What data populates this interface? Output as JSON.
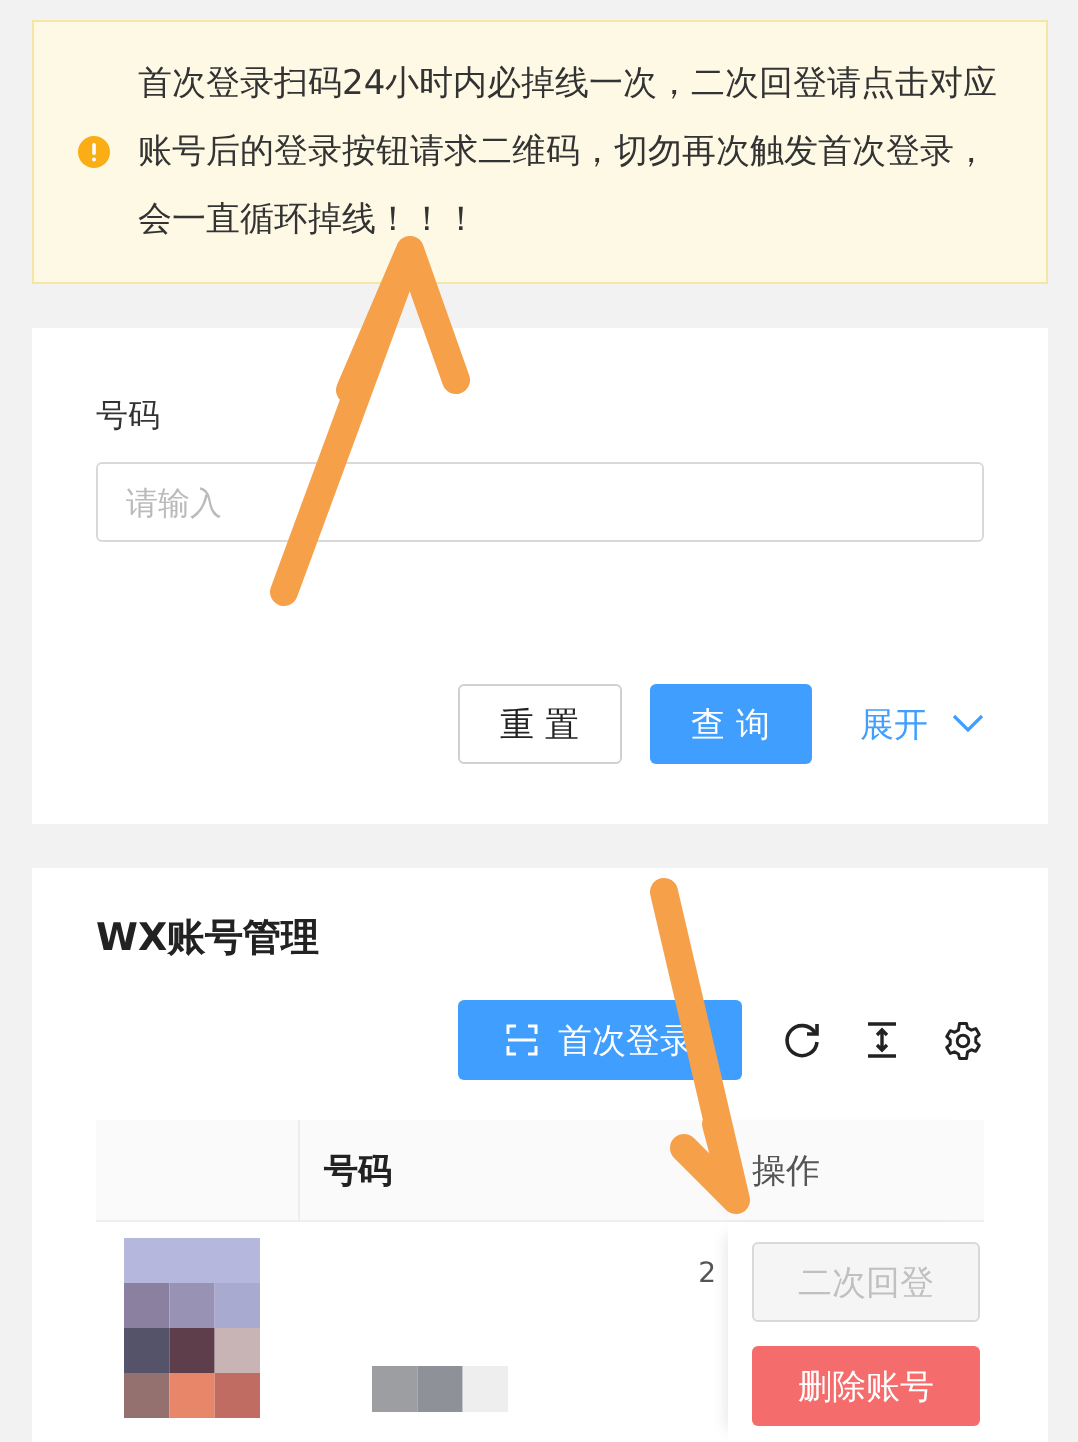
{
  "notice": {
    "kind": "warning",
    "text": "首次登录扫码24小时内必掉线一次，二次回登请点击对应账号后的登录按钮请求二维码，切勿再次触发首次登录，会一直循环掉线！！！"
  },
  "search_form": {
    "fields": [
      {
        "label": "号码",
        "placeholder": "请输入"
      }
    ],
    "buttons": [
      {
        "label": "重 置",
        "kind": "default"
      },
      {
        "label": "查 询",
        "kind": "primary"
      }
    ],
    "expand": {
      "label": "展开",
      "expanded": false
    }
  },
  "account_table": {
    "title": "WX账号管理",
    "toolbar": {
      "primary_button": "首次登录"
    },
    "columns": [
      {},
      {
        "label": "号码"
      },
      {
        "label": "操作"
      }
    ],
    "rows": [
      {
        "avatar": {
          "kind": "picture"
        },
        "column_3_partial": "2",
        "actions": [
          {
            "label": "二次回登",
            "kind": "default",
            "disabled": true
          },
          {
            "label": "删除账号",
            "kind": "danger",
            "disabled": false
          }
        ]
      }
    ]
  },
  "annotations": [
    {
      "kind": "arrow"
    },
    {
      "kind": "arrow"
    }
  ]
}
